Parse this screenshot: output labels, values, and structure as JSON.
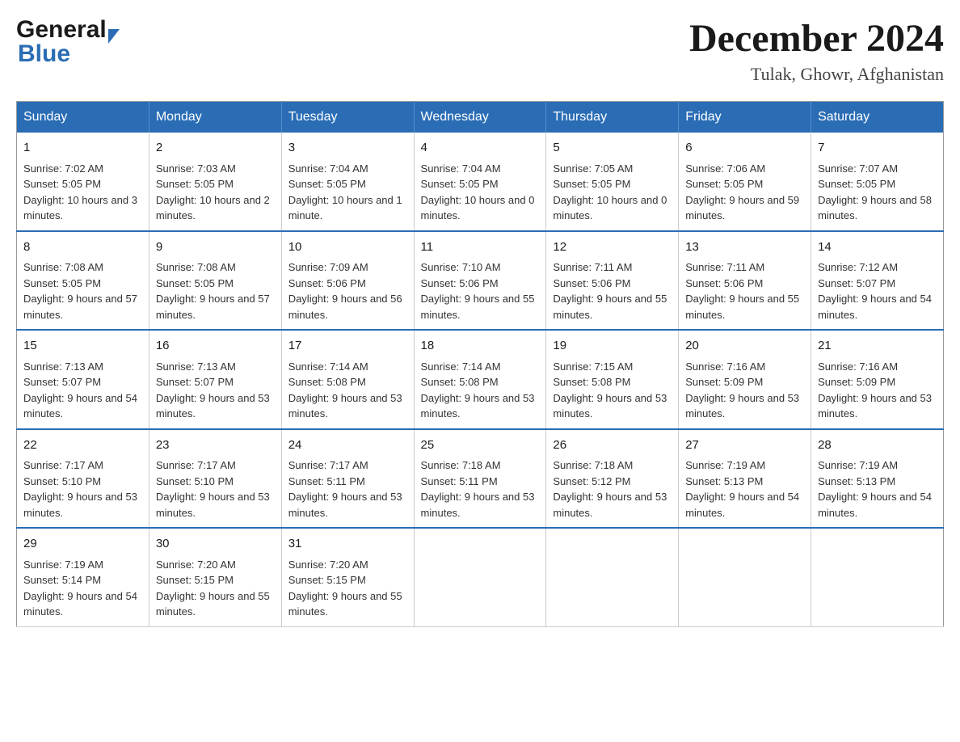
{
  "logo": {
    "general": "General",
    "blue": "Blue"
  },
  "header": {
    "month_year": "December 2024",
    "location": "Tulak, Ghowr, Afghanistan"
  },
  "weekdays": [
    "Sunday",
    "Monday",
    "Tuesday",
    "Wednesday",
    "Thursday",
    "Friday",
    "Saturday"
  ],
  "weeks": [
    [
      {
        "day": "1",
        "sunrise": "Sunrise: 7:02 AM",
        "sunset": "Sunset: 5:05 PM",
        "daylight": "Daylight: 10 hours and 3 minutes."
      },
      {
        "day": "2",
        "sunrise": "Sunrise: 7:03 AM",
        "sunset": "Sunset: 5:05 PM",
        "daylight": "Daylight: 10 hours and 2 minutes."
      },
      {
        "day": "3",
        "sunrise": "Sunrise: 7:04 AM",
        "sunset": "Sunset: 5:05 PM",
        "daylight": "Daylight: 10 hours and 1 minute."
      },
      {
        "day": "4",
        "sunrise": "Sunrise: 7:04 AM",
        "sunset": "Sunset: 5:05 PM",
        "daylight": "Daylight: 10 hours and 0 minutes."
      },
      {
        "day": "5",
        "sunrise": "Sunrise: 7:05 AM",
        "sunset": "Sunset: 5:05 PM",
        "daylight": "Daylight: 10 hours and 0 minutes."
      },
      {
        "day": "6",
        "sunrise": "Sunrise: 7:06 AM",
        "sunset": "Sunset: 5:05 PM",
        "daylight": "Daylight: 9 hours and 59 minutes."
      },
      {
        "day": "7",
        "sunrise": "Sunrise: 7:07 AM",
        "sunset": "Sunset: 5:05 PM",
        "daylight": "Daylight: 9 hours and 58 minutes."
      }
    ],
    [
      {
        "day": "8",
        "sunrise": "Sunrise: 7:08 AM",
        "sunset": "Sunset: 5:05 PM",
        "daylight": "Daylight: 9 hours and 57 minutes."
      },
      {
        "day": "9",
        "sunrise": "Sunrise: 7:08 AM",
        "sunset": "Sunset: 5:05 PM",
        "daylight": "Daylight: 9 hours and 57 minutes."
      },
      {
        "day": "10",
        "sunrise": "Sunrise: 7:09 AM",
        "sunset": "Sunset: 5:06 PM",
        "daylight": "Daylight: 9 hours and 56 minutes."
      },
      {
        "day": "11",
        "sunrise": "Sunrise: 7:10 AM",
        "sunset": "Sunset: 5:06 PM",
        "daylight": "Daylight: 9 hours and 55 minutes."
      },
      {
        "day": "12",
        "sunrise": "Sunrise: 7:11 AM",
        "sunset": "Sunset: 5:06 PM",
        "daylight": "Daylight: 9 hours and 55 minutes."
      },
      {
        "day": "13",
        "sunrise": "Sunrise: 7:11 AM",
        "sunset": "Sunset: 5:06 PM",
        "daylight": "Daylight: 9 hours and 55 minutes."
      },
      {
        "day": "14",
        "sunrise": "Sunrise: 7:12 AM",
        "sunset": "Sunset: 5:07 PM",
        "daylight": "Daylight: 9 hours and 54 minutes."
      }
    ],
    [
      {
        "day": "15",
        "sunrise": "Sunrise: 7:13 AM",
        "sunset": "Sunset: 5:07 PM",
        "daylight": "Daylight: 9 hours and 54 minutes."
      },
      {
        "day": "16",
        "sunrise": "Sunrise: 7:13 AM",
        "sunset": "Sunset: 5:07 PM",
        "daylight": "Daylight: 9 hours and 53 minutes."
      },
      {
        "day": "17",
        "sunrise": "Sunrise: 7:14 AM",
        "sunset": "Sunset: 5:08 PM",
        "daylight": "Daylight: 9 hours and 53 minutes."
      },
      {
        "day": "18",
        "sunrise": "Sunrise: 7:14 AM",
        "sunset": "Sunset: 5:08 PM",
        "daylight": "Daylight: 9 hours and 53 minutes."
      },
      {
        "day": "19",
        "sunrise": "Sunrise: 7:15 AM",
        "sunset": "Sunset: 5:08 PM",
        "daylight": "Daylight: 9 hours and 53 minutes."
      },
      {
        "day": "20",
        "sunrise": "Sunrise: 7:16 AM",
        "sunset": "Sunset: 5:09 PM",
        "daylight": "Daylight: 9 hours and 53 minutes."
      },
      {
        "day": "21",
        "sunrise": "Sunrise: 7:16 AM",
        "sunset": "Sunset: 5:09 PM",
        "daylight": "Daylight: 9 hours and 53 minutes."
      }
    ],
    [
      {
        "day": "22",
        "sunrise": "Sunrise: 7:17 AM",
        "sunset": "Sunset: 5:10 PM",
        "daylight": "Daylight: 9 hours and 53 minutes."
      },
      {
        "day": "23",
        "sunrise": "Sunrise: 7:17 AM",
        "sunset": "Sunset: 5:10 PM",
        "daylight": "Daylight: 9 hours and 53 minutes."
      },
      {
        "day": "24",
        "sunrise": "Sunrise: 7:17 AM",
        "sunset": "Sunset: 5:11 PM",
        "daylight": "Daylight: 9 hours and 53 minutes."
      },
      {
        "day": "25",
        "sunrise": "Sunrise: 7:18 AM",
        "sunset": "Sunset: 5:11 PM",
        "daylight": "Daylight: 9 hours and 53 minutes."
      },
      {
        "day": "26",
        "sunrise": "Sunrise: 7:18 AM",
        "sunset": "Sunset: 5:12 PM",
        "daylight": "Daylight: 9 hours and 53 minutes."
      },
      {
        "day": "27",
        "sunrise": "Sunrise: 7:19 AM",
        "sunset": "Sunset: 5:13 PM",
        "daylight": "Daylight: 9 hours and 54 minutes."
      },
      {
        "day": "28",
        "sunrise": "Sunrise: 7:19 AM",
        "sunset": "Sunset: 5:13 PM",
        "daylight": "Daylight: 9 hours and 54 minutes."
      }
    ],
    [
      {
        "day": "29",
        "sunrise": "Sunrise: 7:19 AM",
        "sunset": "Sunset: 5:14 PM",
        "daylight": "Daylight: 9 hours and 54 minutes."
      },
      {
        "day": "30",
        "sunrise": "Sunrise: 7:20 AM",
        "sunset": "Sunset: 5:15 PM",
        "daylight": "Daylight: 9 hours and 55 minutes."
      },
      {
        "day": "31",
        "sunrise": "Sunrise: 7:20 AM",
        "sunset": "Sunset: 5:15 PM",
        "daylight": "Daylight: 9 hours and 55 minutes."
      },
      null,
      null,
      null,
      null
    ]
  ]
}
